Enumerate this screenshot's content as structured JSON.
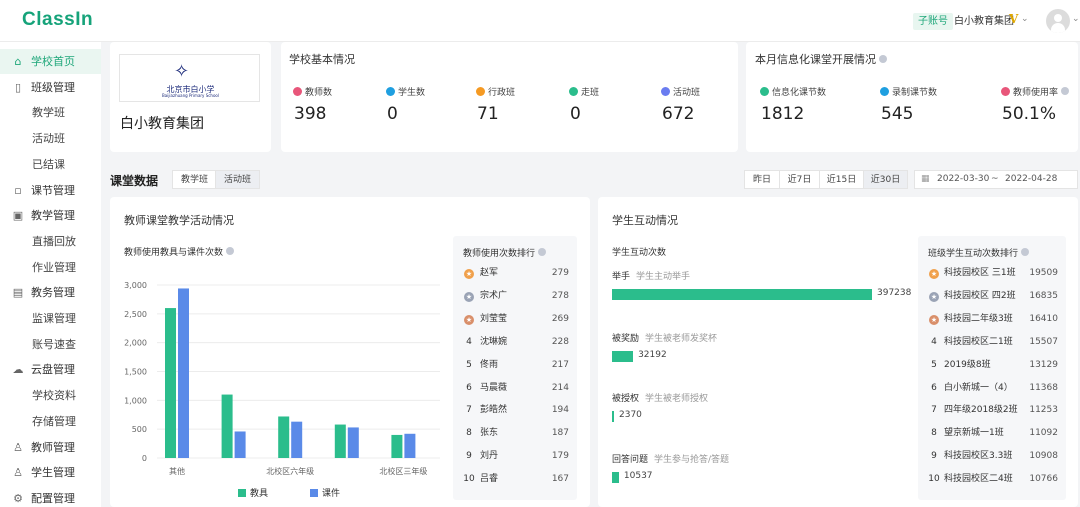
{
  "header": {
    "logo": "ClassIn",
    "sub_account_badge": "子账号",
    "org_name": "白小教育集团",
    "vip_glyph": "V"
  },
  "sidebar": {
    "items": [
      {
        "label": "学校首页",
        "icon": "home-icon",
        "active": true
      },
      {
        "label": "班级管理",
        "icon": "class-icon"
      },
      {
        "label": "教学班",
        "child": true
      },
      {
        "label": "活动班",
        "child": true
      },
      {
        "label": "已结课",
        "child": true
      },
      {
        "label": "课节管理",
        "icon": "lesson-icon"
      },
      {
        "label": "教学管理",
        "icon": "teaching-icon"
      },
      {
        "label": "直播回放",
        "child": true
      },
      {
        "label": "作业管理",
        "child": true
      },
      {
        "label": "教务管理",
        "icon": "academic-icon"
      },
      {
        "label": "监课管理",
        "child": true
      },
      {
        "label": "账号速查",
        "child": true
      },
      {
        "label": "云盘管理",
        "icon": "cloud-icon"
      },
      {
        "label": "学校资料",
        "child": true
      },
      {
        "label": "存储管理",
        "child": true
      },
      {
        "label": "教师管理",
        "icon": "teacher-icon"
      },
      {
        "label": "学生管理",
        "icon": "student-icon"
      },
      {
        "label": "配置管理",
        "icon": "settings-icon"
      }
    ]
  },
  "school": {
    "name": "白小教育集团",
    "logo_text_cn": "北京市白小学",
    "logo_text_en": "Baijiazhuang Primary School"
  },
  "basic_info": {
    "title": "学校基本情况",
    "stats": [
      {
        "label": "教师数",
        "value": "398",
        "color": "#e8567a"
      },
      {
        "label": "学生数",
        "value": "0",
        "color": "#1f9fe0"
      },
      {
        "label": "行政班",
        "value": "71",
        "color": "#f59a23"
      },
      {
        "label": "走班",
        "value": "0",
        "color": "#2bbd8c"
      },
      {
        "label": "活动班",
        "value": "672",
        "color": "#6a7cf0"
      }
    ]
  },
  "monthly_info": {
    "title": "本月信息化课堂开展情况",
    "stats": [
      {
        "label": "信息化课节数",
        "value": "1812",
        "color": "#2bbd8c"
      },
      {
        "label": "录制课节数",
        "value": "545",
        "color": "#1f9fe0"
      },
      {
        "label": "教师使用率",
        "value": "50.1%",
        "color": "#e8567a"
      }
    ]
  },
  "classroom": {
    "title": "课堂数据",
    "tabs": [
      {
        "label": "教学班",
        "active": false
      },
      {
        "label": "活动班",
        "active": true
      }
    ],
    "ranges": [
      {
        "label": "昨日",
        "active": false
      },
      {
        "label": "近7日",
        "active": false
      },
      {
        "label": "近15日",
        "active": false
      },
      {
        "label": "近30日",
        "active": true
      }
    ],
    "date_start": "2022-03-30",
    "date_sep": "~",
    "date_end": "2022-04-28"
  },
  "teacher_panel": {
    "title": "教师课堂教学活动情况",
    "chart_title": "教师使用教具与课件次数",
    "rank_title": "教师使用次数排行",
    "ranking": [
      {
        "rank": "1",
        "name": "赵军",
        "value": "279"
      },
      {
        "rank": "2",
        "name": "宗术广",
        "value": "278"
      },
      {
        "rank": "3",
        "name": "刘莹莹",
        "value": "269"
      },
      {
        "rank": "4",
        "name": "沈琳婉",
        "value": "228"
      },
      {
        "rank": "5",
        "name": "佟雨",
        "value": "217"
      },
      {
        "rank": "6",
        "name": "马晨薇",
        "value": "214"
      },
      {
        "rank": "7",
        "name": "彭皓然",
        "value": "194"
      },
      {
        "rank": "8",
        "name": "张东",
        "value": "187"
      },
      {
        "rank": "9",
        "name": "刘丹",
        "value": "179"
      },
      {
        "rank": "10",
        "name": "吕睿",
        "value": "167"
      }
    ]
  },
  "chart_data": {
    "type": "bar",
    "categories": [
      "其他",
      "",
      "北校区六年级",
      "",
      "北校区三年级"
    ],
    "series": [
      {
        "name": "教具",
        "color": "#2bbd8c",
        "values": [
          2600,
          1100,
          720,
          580,
          400
        ]
      },
      {
        "name": "课件",
        "color": "#5a8ae8",
        "values": [
          2940,
          460,
          630,
          530,
          420
        ]
      }
    ],
    "yticks": [
      "0",
      "500",
      "1,000",
      "1,500",
      "2,000",
      "2,500",
      "3,000"
    ],
    "ylim": [
      0,
      3000
    ],
    "grid": true,
    "legend": "bottom"
  },
  "student_panel": {
    "title": "学生互动情况",
    "sub_title": "学生互动次数",
    "interactions": [
      {
        "label": "举手",
        "hint": "学生主动举手",
        "value": 397238,
        "value_text": "397238"
      },
      {
        "label": "被奖励",
        "hint": "学生被老师发奖杯",
        "value": 32192,
        "value_text": "32192"
      },
      {
        "label": "被授权",
        "hint": "学生被老师授权",
        "value": 2370,
        "value_text": "2370"
      },
      {
        "label": "回答问题",
        "hint": "学生参与抢答/答题",
        "value": 10537,
        "value_text": "10537"
      }
    ],
    "rank_title": "班级学生互动次数排行",
    "ranking": [
      {
        "rank": "1",
        "name": "科技园校区 三1班",
        "value": "19509"
      },
      {
        "rank": "2",
        "name": "科技园校区 四2班",
        "value": "16835"
      },
      {
        "rank": "3",
        "name": "科技园二年级3班",
        "value": "16410"
      },
      {
        "rank": "4",
        "name": "科技园校区二1班",
        "value": "15507"
      },
      {
        "rank": "5",
        "name": "2019级8班",
        "value": "13129"
      },
      {
        "rank": "6",
        "name": "白小新城一（4）",
        "value": "11368"
      },
      {
        "rank": "7",
        "name": "四年级2018级2班",
        "value": "11253"
      },
      {
        "rank": "8",
        "name": "望京新城一1班",
        "value": "11092"
      },
      {
        "rank": "9",
        "name": "科技园校区3.3班",
        "value": "10908"
      },
      {
        "rank": "10",
        "name": "科技园校区二4班",
        "value": "10766"
      }
    ]
  }
}
